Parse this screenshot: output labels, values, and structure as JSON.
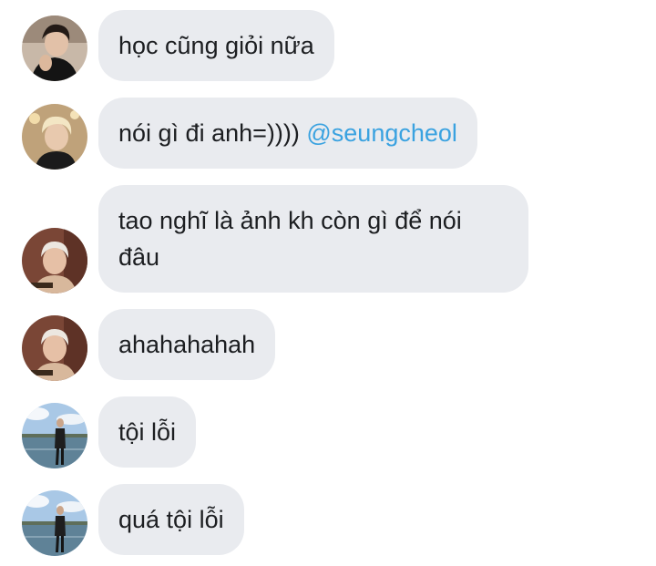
{
  "messages": [
    {
      "text": "học cũng giỏi nữa",
      "avatar": "avatar-dark-hair-man"
    },
    {
      "text": "nói gì đi anh=))))",
      "mention": "@seungcheol",
      "avatar": "avatar-blonde-man"
    },
    {
      "text": "tao nghĩ là ảnh kh còn gì để nói đâu",
      "avatar": "avatar-white-hair-man"
    },
    {
      "text": "ahahahahah",
      "avatar": "avatar-white-hair-man"
    },
    {
      "text": "tội lỗi",
      "avatar": "avatar-lakeside-man"
    },
    {
      "text": "quá tội lỗi",
      "avatar": "avatar-lakeside-man"
    }
  ],
  "colors": {
    "bubble": "#e9ebef",
    "text": "#1c1e21",
    "mention": "#3aa2e0"
  }
}
